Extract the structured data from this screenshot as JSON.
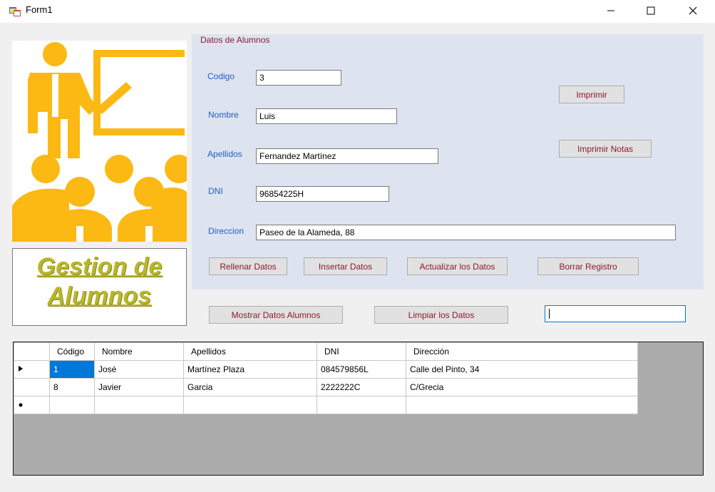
{
  "window": {
    "title": "Form1"
  },
  "group": {
    "title": "Datos de Alumnos"
  },
  "fields": {
    "codigo": {
      "label": "Codigo",
      "value": "3"
    },
    "nombre": {
      "label": "Nombre",
      "value": "Luis"
    },
    "apellidos": {
      "label": "Apellidos",
      "value": "Fernandez Martínez"
    },
    "dni": {
      "label": "DNI",
      "value": "96854225H"
    },
    "direccion": {
      "label": "Direccion",
      "value": "Paseo de la Alameda, 88"
    }
  },
  "buttons": {
    "imprimir": "Imprimir",
    "imprimir_notas": "Imprimir Notas",
    "rellenar": "Rellenar Datos",
    "insertar": "Insertar Datos",
    "actualizar": "Actualizar los Datos",
    "borrar": "Borrar Registro",
    "mostrar": "Mostrar Datos Alumnos",
    "limpiar": "Limpiar los Datos"
  },
  "search": {
    "value": ""
  },
  "logo": {
    "line1": "Gestion de",
    "line2": "Alumnos"
  },
  "grid": {
    "columns": [
      "Código",
      "Nombre",
      "Apellidos",
      "DNI",
      "Dirección"
    ],
    "rows": [
      [
        "1",
        "José",
        "Martínez Plaza",
        "084579856L",
        "Calle del Pinto, 34"
      ],
      [
        "8",
        "Javier",
        "Garcia",
        "2222222C",
        "C/Grecia"
      ],
      [
        "",
        "",
        "",
        "",
        ""
      ]
    ],
    "row_markers": [
      "current-row-arrow",
      "",
      "new-row-asterisk"
    ]
  },
  "colors": {
    "accent": "#0078d7",
    "button_text": "#8b1a2e",
    "label_text": "#1f5fbf",
    "group_bg": "#dde4f0",
    "illustration": "#fdb913",
    "logo_text": "#b8b62a"
  },
  "icons": {
    "app": "form-app-icon",
    "minimize": "minimize-icon",
    "maximize": "maximize-icon",
    "close": "close-icon",
    "illustration": "teacher-classroom-icon"
  }
}
